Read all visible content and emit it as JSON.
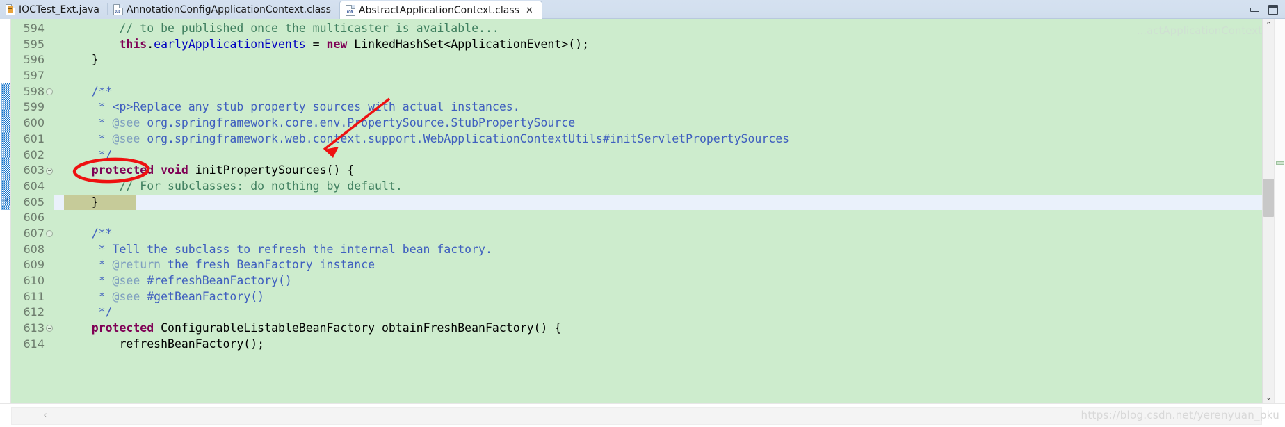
{
  "window": {
    "minimize_label": "Minimize",
    "maximize_label": "Maximize"
  },
  "tabs": [
    {
      "label": "IOCTest_Ext.java",
      "icon": "java-file-icon",
      "active": false,
      "closable": false
    },
    {
      "label": "AnnotationConfigApplicationContext.class",
      "icon": "class-file-icon",
      "active": false,
      "closable": false
    },
    {
      "label": "AbstractApplicationContext.class",
      "icon": "class-file-icon",
      "active": true,
      "closable": true,
      "close_glyph": "✕"
    }
  ],
  "editor": {
    "ghost_watermark": "...actApplicationContext",
    "first_line": 594,
    "current_line": 605,
    "fold_lines": [
      598,
      603,
      607
    ],
    "change_bar_from_line": 598,
    "change_bar_to_line": 605,
    "lines": [
      {
        "n": 594,
        "tokens": [
          {
            "t": "        ",
            "c": "plain"
          },
          {
            "t": "// to be published once the multicaster is available...",
            "c": "cmt"
          }
        ]
      },
      {
        "n": 595,
        "tokens": [
          {
            "t": "        ",
            "c": "plain"
          },
          {
            "t": "this",
            "c": "kw"
          },
          {
            "t": ".",
            "c": "plain"
          },
          {
            "t": "earlyApplicationEvents",
            "c": "fld"
          },
          {
            "t": " = ",
            "c": "plain"
          },
          {
            "t": "new",
            "c": "kw"
          },
          {
            "t": " LinkedHashSet<ApplicationEvent>();",
            "c": "plain"
          }
        ]
      },
      {
        "n": 596,
        "tokens": [
          {
            "t": "    }",
            "c": "plain"
          }
        ]
      },
      {
        "n": 597,
        "tokens": [
          {
            "t": "",
            "c": "plain"
          }
        ]
      },
      {
        "n": 598,
        "tokens": [
          {
            "t": "    ",
            "c": "plain"
          },
          {
            "t": "/**",
            "c": "doc"
          }
        ]
      },
      {
        "n": 599,
        "tokens": [
          {
            "t": "     ",
            "c": "plain"
          },
          {
            "t": "* <p>Replace any stub property sources with actual instances.",
            "c": "doc"
          }
        ]
      },
      {
        "n": 600,
        "tokens": [
          {
            "t": "     ",
            "c": "plain"
          },
          {
            "t": "* ",
            "c": "doc"
          },
          {
            "t": "@see",
            "c": "doctag"
          },
          {
            "t": " org.springframework.core.env.PropertySource.StubPropertySource",
            "c": "doc"
          }
        ]
      },
      {
        "n": 601,
        "tokens": [
          {
            "t": "     ",
            "c": "plain"
          },
          {
            "t": "* ",
            "c": "doc"
          },
          {
            "t": "@see",
            "c": "doctag"
          },
          {
            "t": " org.springframework.web.context.support.WebApplicationContextUtils#initServletPropertySources",
            "c": "doc"
          }
        ]
      },
      {
        "n": 602,
        "tokens": [
          {
            "t": "     ",
            "c": "plain"
          },
          {
            "t": "*/",
            "c": "doc"
          }
        ]
      },
      {
        "n": 603,
        "tokens": [
          {
            "t": "    ",
            "c": "plain"
          },
          {
            "t": "protected",
            "c": "kw"
          },
          {
            "t": " ",
            "c": "plain"
          },
          {
            "t": "void",
            "c": "kw"
          },
          {
            "t": " initPropertySources() {",
            "c": "plain"
          }
        ]
      },
      {
        "n": 604,
        "tokens": [
          {
            "t": "        ",
            "c": "plain"
          },
          {
            "t": "// For subclasses: do nothing by default.",
            "c": "cmt"
          }
        ]
      },
      {
        "n": 605,
        "tokens": [
          {
            "t": "    }",
            "c": "plain"
          }
        ]
      },
      {
        "n": 606,
        "tokens": [
          {
            "t": "",
            "c": "plain"
          }
        ]
      },
      {
        "n": 607,
        "tokens": [
          {
            "t": "    ",
            "c": "plain"
          },
          {
            "t": "/**",
            "c": "doc"
          }
        ]
      },
      {
        "n": 608,
        "tokens": [
          {
            "t": "     ",
            "c": "plain"
          },
          {
            "t": "* Tell the subclass to refresh the internal bean factory.",
            "c": "doc"
          }
        ]
      },
      {
        "n": 609,
        "tokens": [
          {
            "t": "     ",
            "c": "plain"
          },
          {
            "t": "* ",
            "c": "doc"
          },
          {
            "t": "@return",
            "c": "doctag"
          },
          {
            "t": " the fresh BeanFactory instance",
            "c": "doc"
          }
        ]
      },
      {
        "n": 610,
        "tokens": [
          {
            "t": "     ",
            "c": "plain"
          },
          {
            "t": "* ",
            "c": "doc"
          },
          {
            "t": "@see",
            "c": "doctag"
          },
          {
            "t": " #refreshBeanFactory()",
            "c": "doc"
          }
        ]
      },
      {
        "n": 611,
        "tokens": [
          {
            "t": "     ",
            "c": "plain"
          },
          {
            "t": "* ",
            "c": "doc"
          },
          {
            "t": "@see",
            "c": "doctag"
          },
          {
            "t": " #getBeanFactory()",
            "c": "doc"
          }
        ]
      },
      {
        "n": 612,
        "tokens": [
          {
            "t": "     ",
            "c": "plain"
          },
          {
            "t": "*/",
            "c": "doc"
          }
        ]
      },
      {
        "n": 613,
        "tokens": [
          {
            "t": "    ",
            "c": "plain"
          },
          {
            "t": "protected",
            "c": "kw"
          },
          {
            "t": " ConfigurableListableBeanFactory obtainFreshBeanFactory() {",
            "c": "plain"
          }
        ]
      },
      {
        "n": 614,
        "tokens": [
          {
            "t": "        refreshBeanFactory();",
            "c": "plain"
          }
        ]
      }
    ]
  },
  "annotations": {
    "ellipse_target": "protected",
    "ellipse_line": 603,
    "arrow_color": "#ee1111",
    "ellipse_color": "#ee1111"
  },
  "scrollbars": {
    "vertical_up_glyph": "⌃",
    "vertical_down_glyph": "⌄",
    "horizontal_left_glyph": "‹"
  },
  "watermark": "https://blog.csdn.net/yerenyuan_pku",
  "colors": {
    "editor_background": "#cdeccd",
    "gutter_background": "#cdeccd",
    "current_line": "#eaf1fb",
    "selection": "#c6cb99",
    "keyword": "#7f0055",
    "comment": "#3f7f5f",
    "javadoc": "#3f5fbf",
    "javadoc_tag": "#7f9fbf",
    "field": "#0000c0",
    "change_bar": "#0c6fc9",
    "tabbar": "#d3e0ef"
  }
}
